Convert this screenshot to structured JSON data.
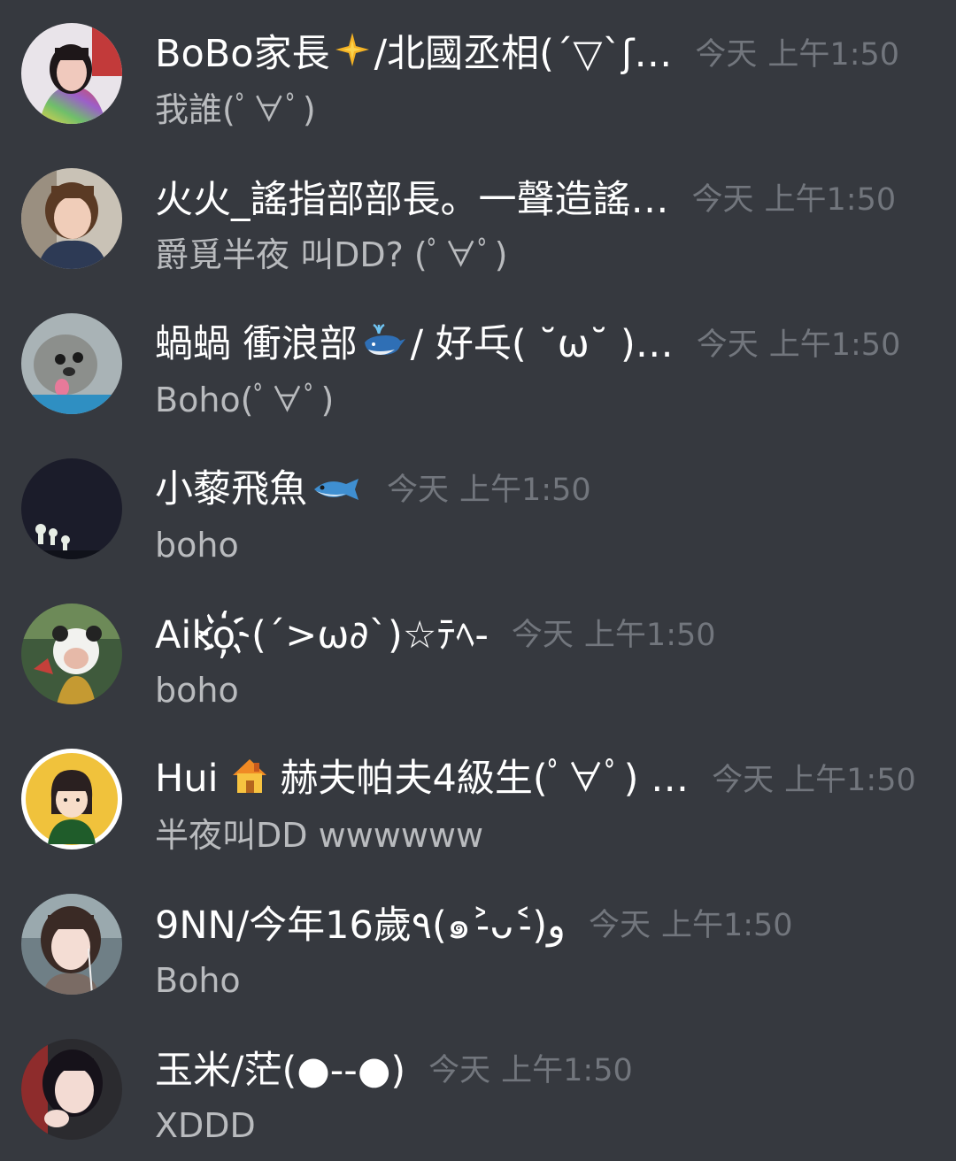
{
  "messages": [
    {
      "username": "BoBo家長",
      "username_suffix": "/北國丞相(´▽`ʃ…",
      "emoji": "sparkle-icon",
      "date": "今天",
      "time": "上午1:50",
      "content": "我誰(ﾟ∀ﾟ)"
    },
    {
      "username": "火火_謠指部部長。一聲造謠…",
      "date": "今天",
      "time": "上午1:50",
      "content": "爵覓半夜 叫DD? (ﾟ∀ﾟ)"
    },
    {
      "username": "蝸蝸 衝浪部",
      "username_suffix": "/ 好乓( ˘ω˘ )…",
      "emoji": "whale-icon",
      "date": "今天",
      "time": "上午1:50",
      "content": "Boho(ﾟ∀ﾟ)"
    },
    {
      "username": "小藜飛魚",
      "emoji": "fish-icon",
      "date": "今天",
      "time": "上午1:50",
      "content": "boho"
    },
    {
      "username": "Aiko҉(´>ω∂`)☆ﾃﾍ-",
      "date": "今天",
      "time": "上午1:50",
      "content": "boho"
    },
    {
      "username": "Hui",
      "username_suffix": "赫夫帕夫4級生(ﾟ∀ﾟ) …",
      "emoji": "house-icon",
      "date": "今天",
      "time": "上午1:50",
      "content": "半夜叫DD wwwwww"
    },
    {
      "username": "9NN/今年16歲٩(๑˃̵ᴗ˂̵)و",
      "date": "今天",
      "time": "上午1:50",
      "content": "Boho"
    },
    {
      "username": "玉米/茫(●--●)",
      "date": "今天",
      "time": "上午1:50",
      "content": "XDDD"
    }
  ],
  "colors": {
    "background": "#36393f",
    "username": "#ffffff",
    "timestamp": "#72767d",
    "content": "#b9bbbe"
  }
}
